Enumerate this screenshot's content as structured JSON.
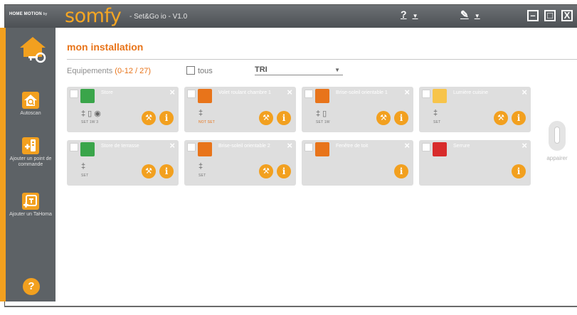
{
  "titlebar": {
    "brand_small": "HOME MOTION",
    "brand_by": "by",
    "brand_logo": "somfy",
    "app_title": "- Set&Go io - V1.0",
    "help_menu": "?",
    "edit_menu": "✎",
    "caret": "▼",
    "minimize": "–",
    "maximize": "□",
    "close": "X"
  },
  "sidebar": {
    "items": [
      {
        "label": "Autoscan",
        "icon": "house-search-icon"
      },
      {
        "label": "Ajouter un point de commande",
        "icon": "add-remote-icon"
      },
      {
        "label": "Ajouter un TaHoma",
        "icon": "add-tahoma-icon"
      }
    ],
    "help": "?"
  },
  "main": {
    "title": "mon installation",
    "equip_label": "Equipements",
    "equip_count": "(0-12 / 27)",
    "tous": "tous",
    "tri": "TRI"
  },
  "cards": [
    {
      "name": "Store",
      "icon": "awning-icon",
      "color": "#3aa54a",
      "conf": "‡ ▯ ◉",
      "labels": "SET  1W   3",
      "wrench": true
    },
    {
      "name": "Volet roulant chambre 1",
      "icon": "roller-shutter-icon",
      "color": "#e8741a",
      "conf": "‡",
      "labels": "NOT SET",
      "notset": true,
      "wrench": true
    },
    {
      "name": "Brise-soleil orientable 1",
      "icon": "venetian-blind-icon",
      "color": "#e8741a",
      "conf": "‡ ▯",
      "labels": "SET  1W",
      "wrench": true
    },
    {
      "name": "Lumière cuisine",
      "icon": "light-bulb-icon",
      "color": "#f7c44b",
      "conf": "‡",
      "labels": "SET",
      "wrench": true
    },
    {
      "name": "Store de terrasse",
      "icon": "awning-icon",
      "color": "#3aa54a",
      "conf": "‡",
      "labels": "SET",
      "wrench": true
    },
    {
      "name": "Brise-soleil orientable 2",
      "icon": "venetian-blind-icon",
      "color": "#e8741a",
      "conf": "‡",
      "labels": "SET",
      "wrench": true
    },
    {
      "name": "Fenêtre de toit",
      "icon": "roof-window-icon",
      "color": "#e8741a",
      "conf": "",
      "labels": "",
      "wrench": false
    },
    {
      "name": "Serrure",
      "icon": "lock-icon",
      "color": "#d82b2b",
      "conf": "",
      "labels": "",
      "wrench": false
    }
  ],
  "appairer": "appairer",
  "colors": {
    "accent": "#f2a01f",
    "title": "#e8741a",
    "sidebar": "#5d6266"
  }
}
